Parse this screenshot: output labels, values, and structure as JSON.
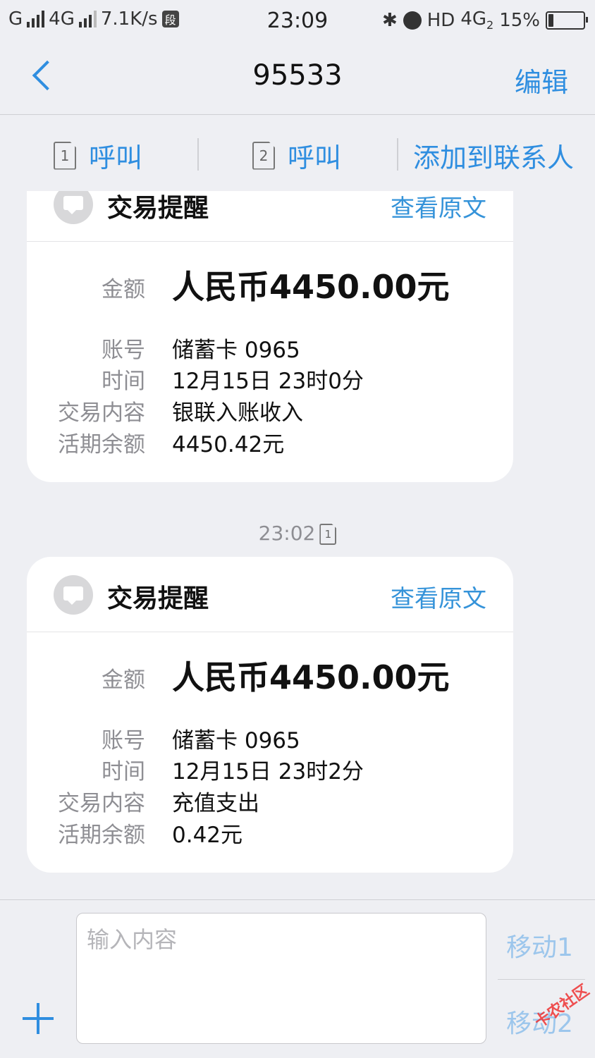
{
  "status_bar": {
    "network1": "G",
    "network2": "4G",
    "speed": "7.1K/s",
    "app_badge": "段",
    "time": "23:09",
    "hd": "HD",
    "network3": "4G",
    "network3_sub": "2",
    "battery_pct": "15%",
    "battery_level": 0.15
  },
  "nav": {
    "title": "95533",
    "edit_label": "编辑"
  },
  "actions": {
    "call1": {
      "sim": "1",
      "label": "呼叫"
    },
    "call2": {
      "sim": "2",
      "label": "呼叫"
    },
    "add_contact": "添加到联系人"
  },
  "messages": [
    {
      "title": "交易提醒",
      "link": "查看原文",
      "amount_label": "金额",
      "amount": "人民币4450.00元",
      "account_label": "账号",
      "account": "储蓄卡 0965",
      "time_label": "时间",
      "time": "12月15日 23时0分",
      "content_label": "交易内容",
      "content": "银联入账收入",
      "balance_label": "活期余额",
      "balance": "4450.42元"
    },
    {
      "timestamp": "23:02",
      "timestamp_sim": "1",
      "title": "交易提醒",
      "link": "查看原文",
      "amount_label": "金额",
      "amount": "人民币4450.00元",
      "account_label": "账号",
      "account": "储蓄卡 0965",
      "time_label": "时间",
      "time": "12月15日 23时2分",
      "content_label": "交易内容",
      "content": "充值支出",
      "balance_label": "活期余额",
      "balance": "0.42元"
    }
  ],
  "composer": {
    "placeholder": "输入内容",
    "send1": "移动1",
    "send2": "移动2"
  },
  "watermark": "卡农社区",
  "colors": {
    "accent": "#2f8ee0",
    "background": "#eeeff3",
    "card": "#ffffff",
    "muted": "#8e8e93"
  }
}
